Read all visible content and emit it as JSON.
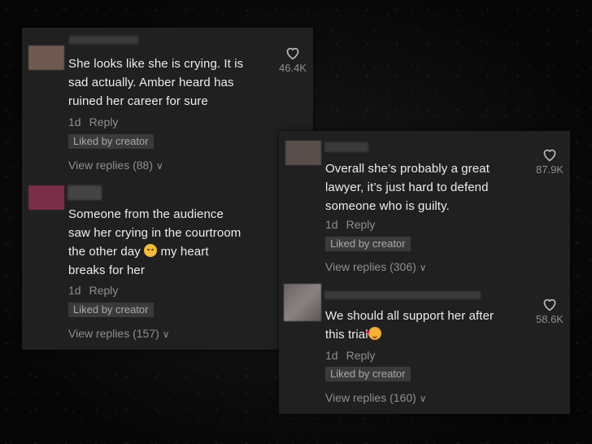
{
  "left_panel": {
    "comments": [
      {
        "avatar_color": "#6e5a50",
        "text_line1": "She looks like she is crying. It is",
        "text_line2": "sad actually. Amber heard has",
        "text_line3": "ruined her career for sure",
        "time": "1d",
        "reply_label": "Reply",
        "badge": "Liked by creator",
        "view_replies": "View replies (88)",
        "likes": "46.4K"
      },
      {
        "avatar_color": "#7a2f48",
        "text_line1": "Someone from the audience",
        "text_line2": "saw her crying in the courtroom",
        "text_line3_before": "the other day",
        "text_line3_after": "my heart",
        "text_line4": "breaks for her",
        "time": "1d",
        "reply_label": "Reply",
        "badge": "Liked by creator",
        "view_replies": "View replies (157)"
      }
    ]
  },
  "right_panel": {
    "comments": [
      {
        "avatar_color": "#5a4e4c",
        "text_line1": "Overall she’s probably a great",
        "text_line2": "lawyer, it’s just hard to defend",
        "text_line3": "someone who is guilty.",
        "time": "1d",
        "reply_label": "Reply",
        "badge": "Liked by creator",
        "view_replies": "View replies (306)",
        "likes": "87.9K"
      },
      {
        "avatar_color": "#6a6262",
        "text_line1": "We should all support her after",
        "text_line2": "this trial",
        "time": "1d",
        "reply_label": "Reply",
        "badge": "Liked by creator",
        "view_replies": "View replies (160)",
        "likes": "58.6K"
      }
    ]
  },
  "icons": {
    "heart": "heart-icon",
    "chevron": "chevron-down-icon",
    "sad_emoji": "disappointed-face-emoji",
    "love_emoji": "smiling-face-with-hearts-emoji"
  }
}
